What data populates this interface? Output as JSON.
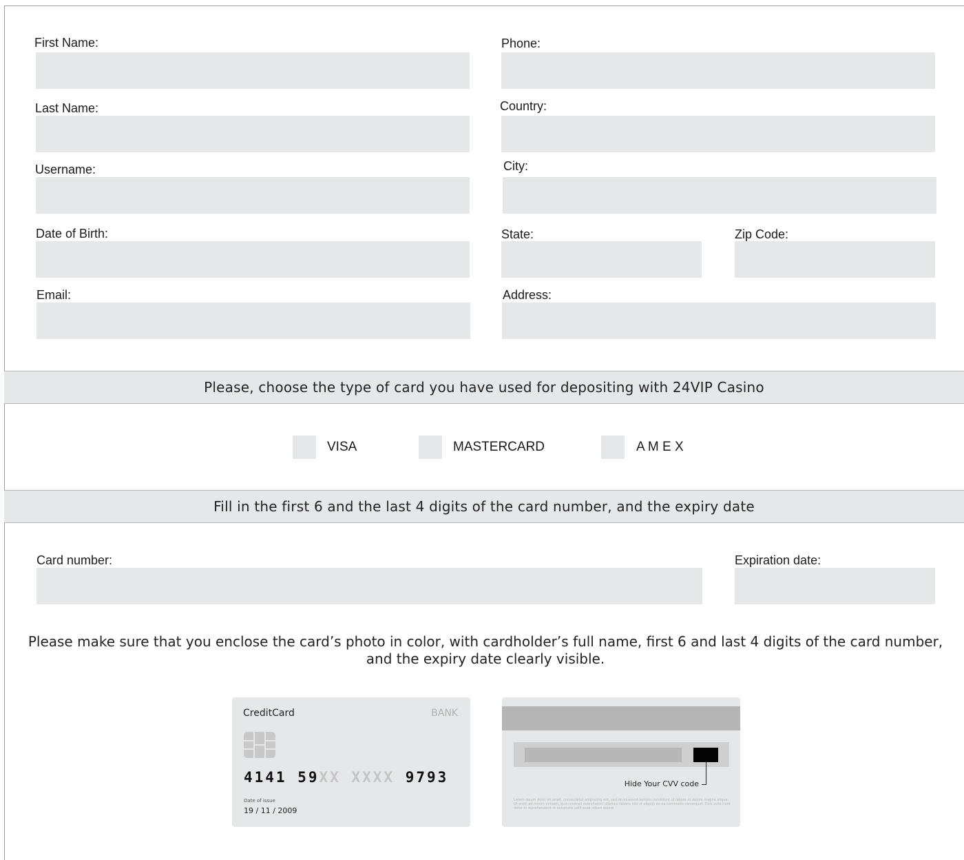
{
  "personal": {
    "first_name": "First Name:",
    "last_name": "Last Name:",
    "username": "Username:",
    "dob": "Date of Birth:",
    "email": "Email:"
  },
  "location": {
    "phone": "Phone:",
    "country": "Country:",
    "city": "City:",
    "state": "State:",
    "zip": "Zip Code:",
    "address": "Address:"
  },
  "card_type_section": {
    "heading": "Please, choose the type of card you have used for depositing with 24VIP Casino",
    "options": [
      "VISA",
      "MASTERCARD",
      "A M E X"
    ]
  },
  "card_number_section": {
    "heading": "Fill in the first 6 and the last 4 digits of the card number, and the expiry date",
    "card_number_label": "Card number:",
    "expiration_label": "Expiration date:"
  },
  "note": "Please make sure that you enclose the card’s photo in color, with cardholder’s full name, first 6 and last 4 digits of the card number, and the expiry date clearly visible.",
  "card_front": {
    "title": "CreditCard",
    "bank": "BANK",
    "number_visible_start": "4141 59",
    "number_masked": "XX XXXX",
    "number_visible_end": "9793",
    "date_label": "Date of issue",
    "date_value": "19 / 11 / 2009"
  },
  "card_back": {
    "cvv_hint": "Hide Your CVV code",
    "fine_print": "Lorem ipsum dolor sit amet, consectetur adipiscing elit, sed do eiusmod tempor incididunt ut labore et dolore magna aliqua. Ut enim ad minim veniam, quis nostrud exercitation ullamco laboris nisi ut aliquip ex ea commodo consequat. Duis aute irure dolor in reprehenderit in voluptate velit esse cillum dolore."
  },
  "colors": {
    "field_bg": "#e6e7e8",
    "border": "#9a9a9a",
    "masked_digits": "#c4c4c4"
  }
}
